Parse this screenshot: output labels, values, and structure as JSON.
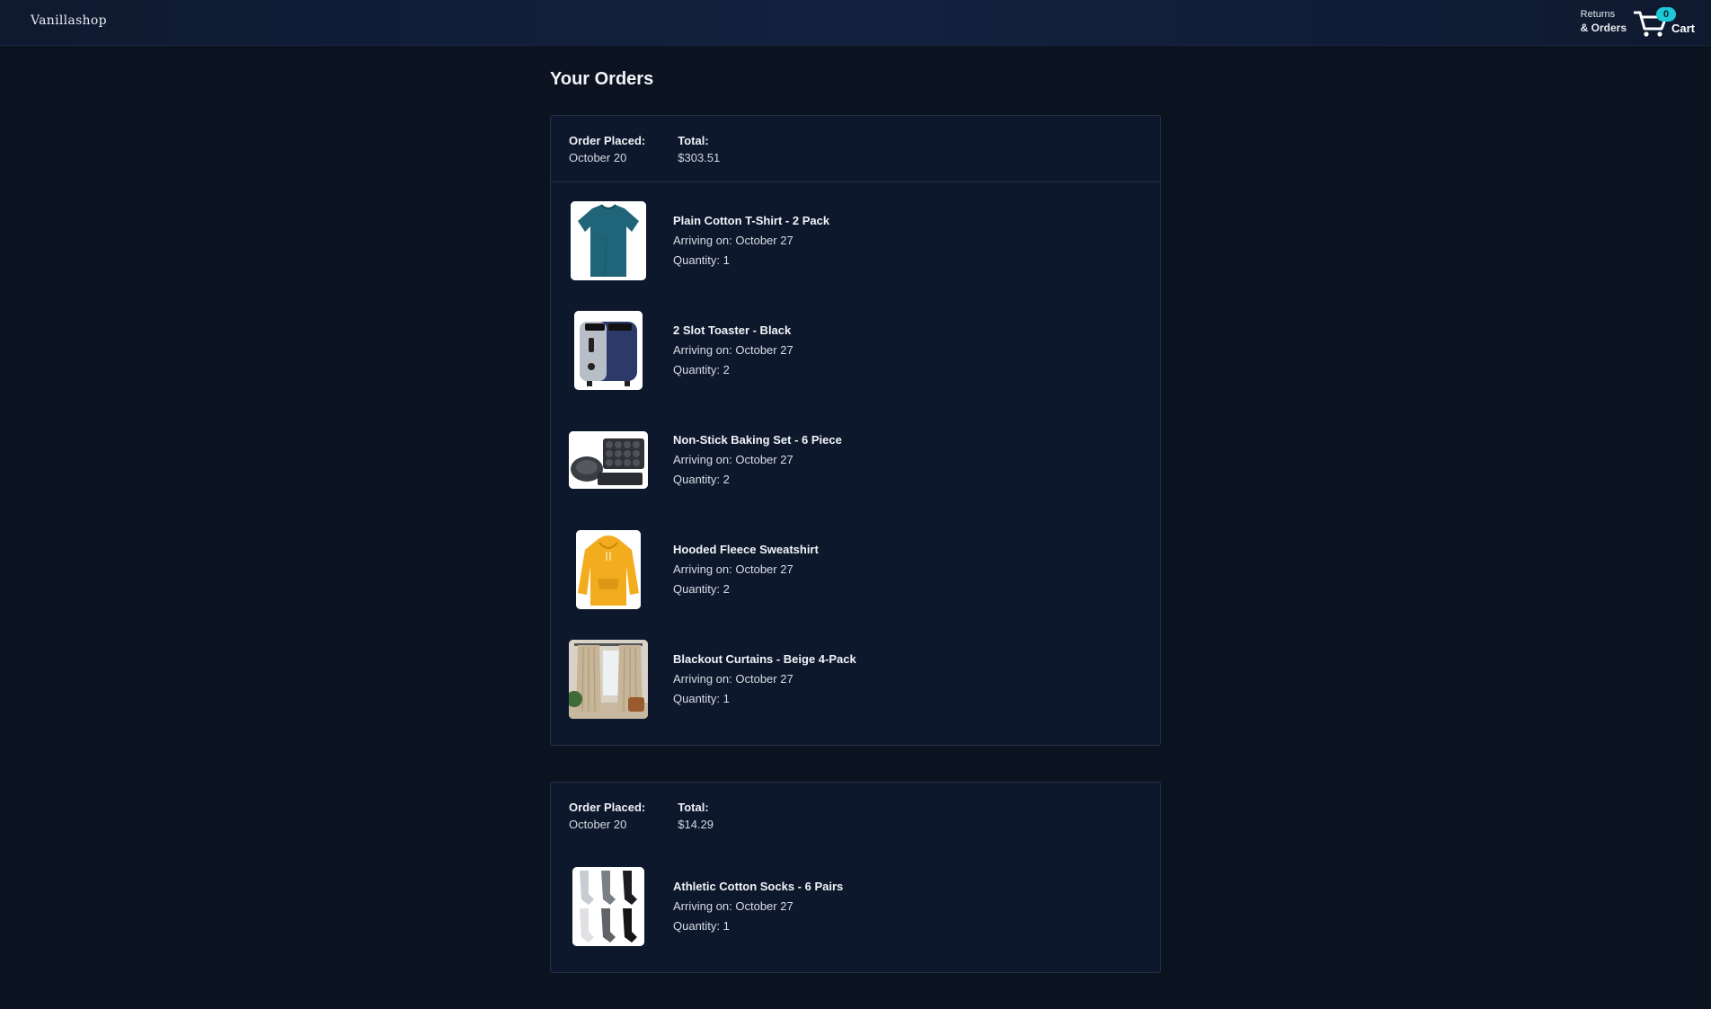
{
  "header": {
    "logo": "Vanillashop",
    "returns_line1": "Returns",
    "returns_line2": "& Orders",
    "cart_count": "0",
    "cart_label": "Cart",
    "cart_icon": "cart-icon"
  },
  "page_title": "Your Orders",
  "labels": {
    "order_placed": "Order Placed:",
    "total": "Total:",
    "arriving_prefix": "Arriving on:",
    "quantity_prefix": "Quantity:"
  },
  "orders": [
    {
      "placed": "October 20",
      "total": "$303.51",
      "items": [
        {
          "name": "Plain Cotton T-Shirt - 2 Pack",
          "arriving": "Arriving on: October 27",
          "quantity": "Quantity: 1",
          "image": "teal-tshirt-image"
        },
        {
          "name": "2 Slot Toaster - Black",
          "arriving": "Arriving on: October 27",
          "quantity": "Quantity: 2",
          "image": "black-toaster-image"
        },
        {
          "name": "Non-Stick Baking Set - 6 Piece",
          "arriving": "Arriving on: October 27",
          "quantity": "Quantity: 2",
          "image": "baking-set-image"
        },
        {
          "name": "Hooded Fleece Sweatshirt",
          "arriving": "Arriving on: October 27",
          "quantity": "Quantity: 2",
          "image": "yellow-hoodie-image"
        },
        {
          "name": "Blackout Curtains - Beige 4-Pack",
          "arriving": "Arriving on: October 27",
          "quantity": "Quantity: 1",
          "image": "beige-curtains-image"
        }
      ]
    },
    {
      "placed": "October 20",
      "total": "$14.29",
      "items": [
        {
          "name": "Athletic Cotton Socks - 6 Pairs",
          "arriving": "Arriving on: October 27",
          "quantity": "Quantity: 1",
          "image": "socks-image"
        }
      ]
    }
  ],
  "colors": {
    "background": "#0b1220",
    "panel": "#0e182c",
    "badge": "#1ec8d8"
  }
}
